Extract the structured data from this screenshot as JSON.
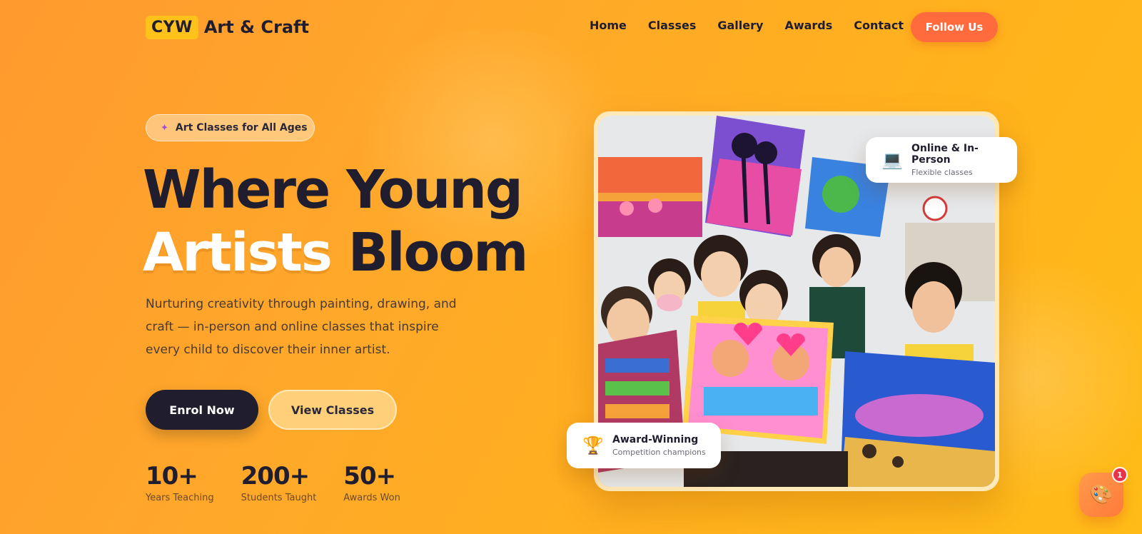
{
  "nav": {
    "logo_badge": "CYW",
    "logo_text": "Art & Craft",
    "links": [
      "Home",
      "Classes",
      "Gallery",
      "Awards",
      "Contact"
    ],
    "follow_label": "Follow Us"
  },
  "hero": {
    "pill_text": "Art Classes for All Ages",
    "headline_line1": "Where Young",
    "headline_highlight": "Artists",
    "headline_line2_rest": "Bloom",
    "description": "Nurturing creativity through painting, drawing, and craft — in-person and online classes that inspire every child to discover their inner artist.",
    "primary_button": "Enrol Now",
    "secondary_button": "View Classes",
    "stats": [
      {
        "value": "10+",
        "label": "Years Teaching"
      },
      {
        "value": "200+",
        "label": "Students Taught"
      },
      {
        "value": "50+",
        "label": "Awards Won"
      }
    ]
  },
  "cards": {
    "online_title": "Online & In-Person",
    "online_sub": "Flexible classes",
    "award_title": "Award-Winning",
    "award_sub": "Competition champions"
  },
  "chat": {
    "badge_count": "1"
  },
  "colors": {
    "dark": "#1f1d2e",
    "accent": "#ff6b3d",
    "logo_badge": "#ffc21a"
  }
}
